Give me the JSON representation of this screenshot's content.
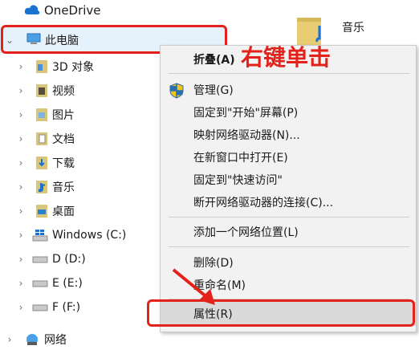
{
  "nav": {
    "onedrive": "OneDrive",
    "thispc": "此电脑",
    "items": [
      {
        "label": "3D 对象",
        "icon": "3d-objects-icon"
      },
      {
        "label": "视频",
        "icon": "videos-icon"
      },
      {
        "label": "图片",
        "icon": "pictures-icon"
      },
      {
        "label": "文档",
        "icon": "documents-icon"
      },
      {
        "label": "下载",
        "icon": "downloads-icon"
      },
      {
        "label": "音乐",
        "icon": "music-icon"
      },
      {
        "label": "桌面",
        "icon": "desktop-icon"
      },
      {
        "label": "Windows (C:)",
        "icon": "windows-drive-icon"
      },
      {
        "label": "D (D:)",
        "icon": "drive-icon"
      },
      {
        "label": "E (E:)",
        "icon": "drive-icon"
      },
      {
        "label": "F (F:)",
        "icon": "drive-icon"
      }
    ],
    "network": "网络"
  },
  "right_pane": {
    "folder_label": "音乐"
  },
  "annotation": {
    "text": "右键单击"
  },
  "context_menu": {
    "collapse": "折叠(A)",
    "manage": "管理(G)",
    "pin_start": "固定到\"开始\"屏幕(P)",
    "map_drive": "映射网络驱动器(N)...",
    "open_new_window": "在新窗口中打开(E)",
    "pin_quick": "固定到\"快速访问\"",
    "disconnect": "断开网络驱动器的连接(C)...",
    "add_location": "添加一个网络位置(L)",
    "delete": "删除(D)",
    "rename": "重命名(M)",
    "properties": "属性(R)"
  },
  "colors": {
    "annotation_red": "#e3221b",
    "selection": "#e5f1fb",
    "menu_bg": "#f2f2f2"
  }
}
